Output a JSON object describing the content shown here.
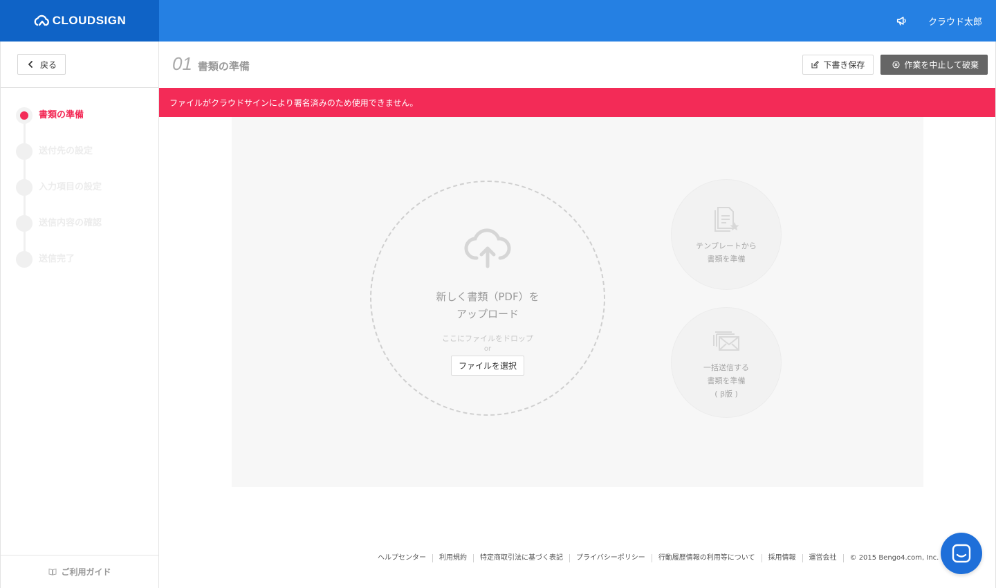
{
  "header": {
    "brand": "CLOUDSIGN",
    "user_name": "クラウド太郎",
    "icons": {
      "announce": "megaphone-icon"
    }
  },
  "sidebar": {
    "back_label": "戻る",
    "steps": [
      {
        "label": "書類の準備",
        "active": true
      },
      {
        "label": "送付先の設定",
        "active": false
      },
      {
        "label": "入力項目の設定",
        "active": false
      },
      {
        "label": "送信内容の確認",
        "active": false
      },
      {
        "label": "送信完了",
        "active": false
      }
    ],
    "guide_label": "ご利用ガイド"
  },
  "page": {
    "number": "01",
    "title": "書類の準備",
    "draft_label": "下書き保存",
    "discard_label": "作業を中止して破棄"
  },
  "alert": {
    "message": "ファイルがクラウドサインにより署名済みのため使用できません。"
  },
  "upload": {
    "title_line1": "新しく書類（PDF）を",
    "title_line2": "アップロード",
    "drop_hint": "ここにファイルをドロップ",
    "or": "or",
    "select_label": "ファイルを選択"
  },
  "options": {
    "template": {
      "line1": "テンプレートから",
      "line2": "書類を準備"
    },
    "bulk": {
      "line1": "一括送信する",
      "line2": "書類を準備",
      "line3": "( β版 )"
    }
  },
  "footer": {
    "links": [
      "ヘルプセンター",
      "利用規約",
      "特定商取引法に基づく表記",
      "プライバシーポリシー",
      "行動履歴情報の利用等について",
      "採用情報",
      "運営会社"
    ],
    "copyright": "© 2015 Bengo4.com, Inc."
  },
  "colors": {
    "brand_blue": "#2580e3",
    "brand_dark_blue": "#0f63c6",
    "alert_red": "#f32b57",
    "chat_blue": "#1e6fd9"
  }
}
